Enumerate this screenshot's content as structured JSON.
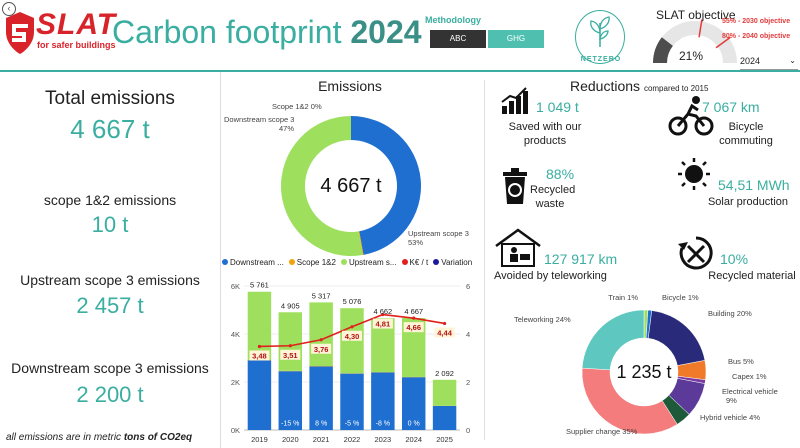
{
  "header": {
    "back_icon": "back-arrow-icon",
    "brand": "SLAT",
    "tagline": "for safer buildings",
    "title_prefix": "Carbon footprint",
    "title_year": "2024",
    "methodology_label": "Methodology",
    "methods": [
      "ABC",
      "GHG"
    ],
    "netzero_label": "NETZERO",
    "objective_title": "SLAT objective",
    "objective_pct": "21%",
    "objective_fill": 0.21,
    "objective_2030": "55% - 2030 objective",
    "objective_2040": "80% - 2040 objective",
    "year_selected": "2024",
    "colors": {
      "teal": "#3aaea0",
      "red": "#d9232a",
      "dark": "#333333"
    }
  },
  "totals": {
    "total_label": "Total emissions",
    "total_value": "4 667 t",
    "s12_label": "scope 1&2 emissions",
    "s12_value": "10 t",
    "up_label": "Upstream scope 3 emissions",
    "up_value": "2 457 t",
    "down_label": "Downstream scope 3 emissions",
    "down_value": "2 200 t",
    "footnote_prefix": "all emissions are in metric ",
    "footnote_bold": "tons of CO2eq"
  },
  "emissions": {
    "title": "Emissions",
    "center_label": "4 667 t"
  },
  "reductions": {
    "title": "Reductions",
    "subtitle": "compared to 2015",
    "items": [
      {
        "icon": "chart-up-icon",
        "value": "1 049 t",
        "label": "Saved with our products"
      },
      {
        "icon": "bicycle-icon",
        "value": "7 067 km",
        "label": "Bicycle commuting"
      },
      {
        "icon": "recycle-bin-icon",
        "value": "88%",
        "label": "Recycled waste"
      },
      {
        "icon": "sun-icon",
        "value": "54,51 MWh",
        "label": "Solar production"
      },
      {
        "icon": "telework-house-icon",
        "value": "127 917 km",
        "label": "Avoided by teleworking"
      },
      {
        "icon": "recycle-tools-icon",
        "value": "10%",
        "label": "Recycled material"
      }
    ],
    "center_label": "1 235 t"
  },
  "chart_data": [
    {
      "type": "pie",
      "categories": [
        "Downstream scope 3",
        "Scope 1&2",
        "Upstream scope 3"
      ],
      "values": [
        2200,
        10,
        2457
      ],
      "labels": [
        "Downstream scope 3 47%",
        "Scope 1&2 0%",
        "Upstream scope 3 53%"
      ],
      "colors": [
        "#1f6fd1",
        "#f0a30a",
        "#9ee05e"
      ],
      "center": "4 667 t"
    },
    {
      "type": "bar",
      "categories": [
        "2019",
        "2020",
        "2021",
        "2022",
        "2023",
        "2024",
        "2025"
      ],
      "series": [
        {
          "name": "Downstream ...",
          "values": [
            2900,
            2450,
            2650,
            2350,
            2400,
            2200,
            1000
          ],
          "color": "#1f6fd1"
        },
        {
          "name": "Scope 1&2",
          "values": [
            20,
            15,
            15,
            12,
            12,
            10,
            5
          ],
          "color": "#f0a30a"
        },
        {
          "name": "Upstream s...",
          "values": [
            2841,
            2440,
            2652,
            2714,
            2250,
            2457,
            1087
          ],
          "color": "#9ee05e"
        }
      ],
      "totals": [
        "5 761",
        "4 905",
        "5 317",
        "5 076",
        "4 662",
        "4 667",
        "2 092"
      ],
      "line": {
        "name": "K€ / t",
        "values": [
          3.48,
          3.51,
          3.76,
          4.3,
          4.81,
          4.66,
          4.44
        ],
        "labels": [
          "3,48",
          "3,51",
          "3,76",
          "4,30",
          "4,81",
          "4,66",
          "4,44"
        ],
        "color": "#e0201c"
      },
      "variation": {
        "name": "Variation",
        "labels": [
          "",
          "-15 %",
          "8 %",
          "-5 %",
          "-8 %",
          "0 %",
          ""
        ],
        "color": "#1a1a9a"
      },
      "yticks": [
        "0K",
        "2K",
        "4K",
        "6K"
      ],
      "y2ticks": [
        "0",
        "2",
        "4",
        "6"
      ],
      "ylim": [
        0,
        6000
      ],
      "y2lim": [
        0,
        6
      ]
    },
    {
      "type": "pie",
      "categories": [
        "Train",
        "Bicycle",
        "Building",
        "Bus",
        "Capex",
        "Electrical vehicle",
        "Hybrid vehicle",
        "Supplier change",
        "Teleworking"
      ],
      "values": [
        1,
        1,
        20,
        5,
        1,
        9,
        4,
        35,
        24
      ],
      "labels": [
        "Train 1%",
        "Bicycle 1%",
        "Building 20%",
        "Bus 5%",
        "Capex 1%",
        "Electrical vehicle 9%",
        "Hybrid vehicle 4%",
        "Supplier change 35%",
        "Teleworking 24%"
      ],
      "colors": [
        "#9ee05e",
        "#1f6fd1",
        "#2a2a7a",
        "#f07a2a",
        "#7a3aa0",
        "#5b3a9a",
        "#1e5a3a",
        "#f47c7c",
        "#5ec8c0"
      ],
      "center": "1 235 t"
    }
  ]
}
